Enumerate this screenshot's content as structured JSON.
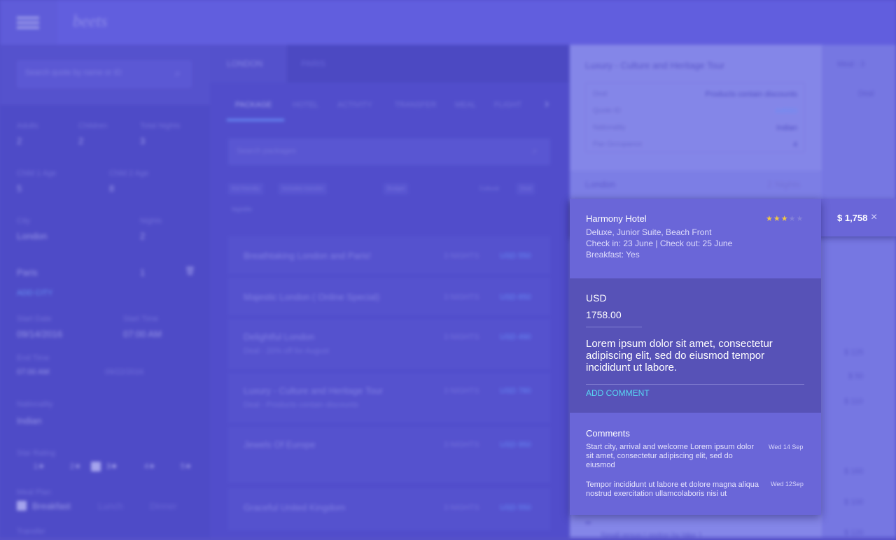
{
  "header": {
    "logo": "beets"
  },
  "sidebar": {
    "search_placeholder": "Search quote by name or ID",
    "adults_label": "Adults",
    "adults": "2",
    "children_label": "Children",
    "children": "2",
    "total_nights_label": "Total Nights",
    "total_nights": "3",
    "child1_label": "Child 1 Age",
    "child1": "5",
    "child2_label": "Child 2 Age",
    "child2": "8",
    "city_label": "City",
    "city1": "London",
    "nights_label": "Nights",
    "nights1": "2",
    "city2": "Paris",
    "nights2": "1",
    "add_city": "ADD CITY",
    "start_date_label": "Start Date",
    "start_date": "09/14/2016",
    "start_time_label": "Start Time",
    "start_time": "07:00 AM",
    "end_time_label": "End Time",
    "end_time": "07:00 AM",
    "end_date": "09/22/2016",
    "nationality_label": "Nationality",
    "nationality": "Indian",
    "star_label": "Star Rating",
    "stars": [
      "1★",
      "2★",
      "3★",
      "4★",
      "5★"
    ],
    "meal_label": "Meal Plan",
    "meals": [
      "Breakfast",
      "Lunch",
      "Dinner"
    ],
    "transfer_label": "Transfer"
  },
  "center": {
    "city_tabs": [
      "LONDON",
      "PARIS"
    ],
    "sub_tabs": [
      "PACKAGE",
      "HOTEL",
      "ACTIVITY",
      "TRANSFER",
      "MEAL",
      "FLIGHT"
    ],
    "search_placeholder": "Search packages",
    "chips": [
      "Kid friendly",
      "Includes transfer",
      "Budget",
      "Cultural",
      "Deal",
      "Nightlife"
    ],
    "packages": [
      {
        "title": "Breathtaking London and Paris!",
        "nights": "3 NIGHTS",
        "price": "USD 550",
        "deal": ""
      },
      {
        "title": "Majestic London ( Online Special)",
        "nights": "3 NIGHTS",
        "price": "USD 650",
        "deal": ""
      },
      {
        "title": "Delightful London",
        "nights": "3 NIGHTS",
        "price": "USD 490",
        "deal": "Deal - 20% off for August"
      },
      {
        "title": "Luxury - Culture and Heritage Tour",
        "nights": "3 NIGHTS",
        "price": "USD 780",
        "deal": "Deal - Products contain discounts"
      },
      {
        "title": "Jewels Of Europe",
        "nights": "3 NIGHTS",
        "price": "USD 950",
        "deal": ""
      },
      {
        "title": "Graceful United Kingdom",
        "nights": "3 NIGHTS",
        "price": "USD 550",
        "deal": ""
      }
    ]
  },
  "right": {
    "title": "Luxury - Culture and Heritage Tour",
    "meal_summary": "Meal : 3",
    "deal_label": "Deal",
    "deal_value": "Products contain discounts",
    "quote_label": "Quote ID",
    "quote_value": "A4593",
    "nationality_label": "Nationality",
    "nationality_value": "Indian",
    "pax_label": "Pax Occupance",
    "pax_value": "4",
    "band_city": "London",
    "band_nights": "2 Nights",
    "prices": [
      "$ 125",
      "$ 50",
      "$ 110",
      "$ 160",
      "$ 100",
      "$ 120"
    ],
    "bottom_text": "Small group London by bike 1"
  },
  "popup": {
    "hotel_name": "Harmony Hotel",
    "room": "Deluxe, Junior Suite, Beach Front",
    "dates": "Check in: 23 June | Check out: 25 June",
    "breakfast": "Breakfast: Yes",
    "rating": 3,
    "rating_max": 5,
    "star_on_color": "#f2c744",
    "total": "$ 1,758",
    "close_icon": "×",
    "currency": "USD",
    "amount": "1758.00",
    "description": "Lorem ipsum dolor sit amet, consectetur adipiscing elit, sed do eiusmod tempor incididunt ut labore.",
    "add_comment": "ADD COMMENT",
    "comments_title": "Comments",
    "comments": [
      {
        "text": "Start city, arrival and welcome  Lorem ipsum dolor sit amet, consectetur adipiscing elit, sed do eiusmod",
        "date": "Wed 14 Sep"
      },
      {
        "text": "Tempor incididunt ut labore et dolore magna aliqua nostrud exercitation ullamcolaboris nisi ut",
        "date": "Wed 12Sep"
      }
    ]
  }
}
